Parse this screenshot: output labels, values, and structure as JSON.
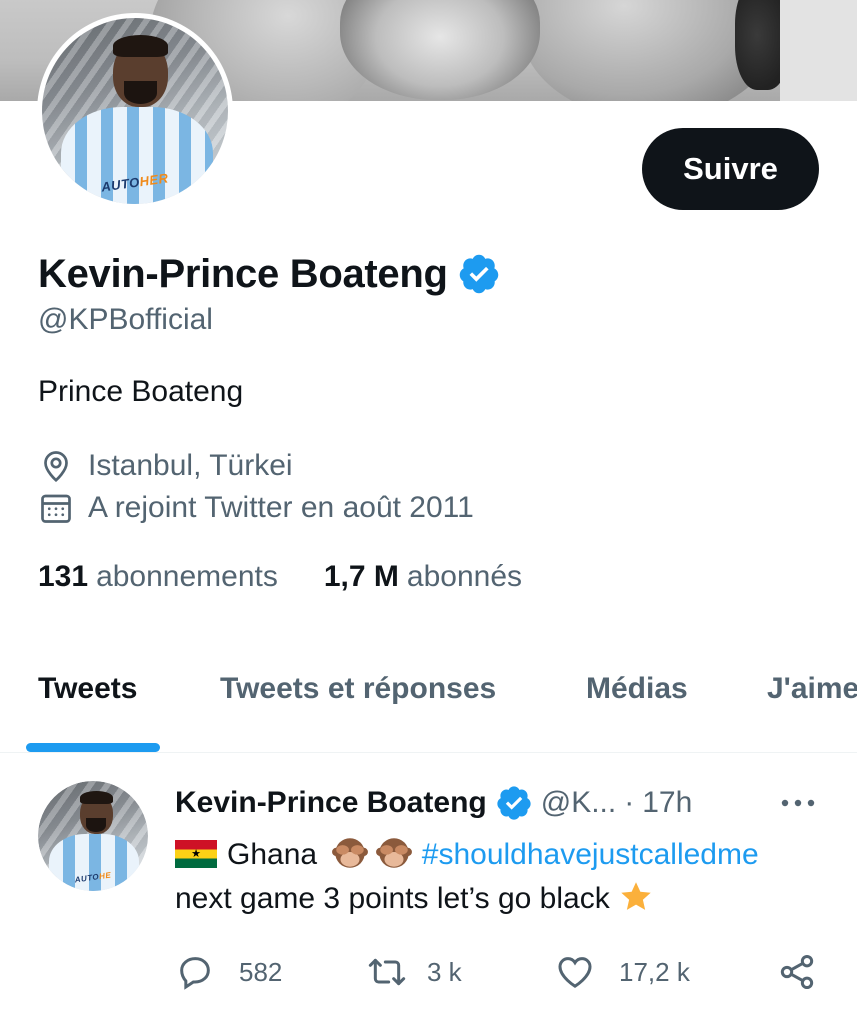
{
  "profile": {
    "follow_label": "Suivre",
    "display_name": "Kevin-Prince Boateng",
    "handle": "@KPBofficial",
    "bio": "Prince Boateng",
    "location": "Istanbul, Türkei",
    "joined": "A rejoint Twitter en août 2011",
    "avatar_sponsor_a": "AUTO",
    "avatar_sponsor_b": "HER",
    "stats": {
      "following_count": "131",
      "following_label": "abonnements",
      "followers_count": "1,7 M",
      "followers_label": "abonnés"
    }
  },
  "tabs": [
    {
      "label": "Tweets",
      "active": true
    },
    {
      "label": "Tweets et réponses",
      "active": false
    },
    {
      "label": "Médias",
      "active": false
    },
    {
      "label": "J'aime",
      "active": false
    }
  ],
  "tweet": {
    "author_name": "Kevin-Prince Boateng",
    "author_handle": "@K...",
    "separator": "·",
    "time": "17h",
    "text_country": "Ghana",
    "hashtag": "#shouldhavejustcalledme",
    "text_line2": "next game 3 points let’s go black",
    "avatar_sponsor_a": "AUTO",
    "avatar_sponsor_b": "HE",
    "reply_count": "582",
    "retweet_count": "3 k",
    "like_count": "17,2 k"
  },
  "icons": {
    "verified": "verified-badge-icon",
    "location": "location-pin-icon",
    "calendar": "calendar-icon",
    "more": "more-options-icon",
    "reply": "reply-icon",
    "retweet": "retweet-icon",
    "like": "heart-icon",
    "share": "share-icon",
    "flag": "ghana-flag-icon",
    "monkey": "see-no-evil-monkey-icon",
    "star": "star-icon"
  },
  "colors": {
    "accent": "#1d9bf0",
    "text_primary": "#0f1419",
    "text_secondary": "#536471",
    "button_bg": "#0f1419"
  }
}
